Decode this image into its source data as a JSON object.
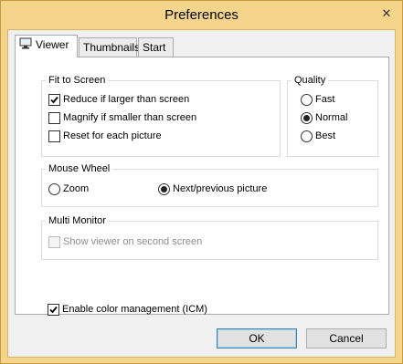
{
  "window": {
    "title": "Preferences",
    "close_glyph": "✕"
  },
  "tabs": [
    {
      "label": "Viewer",
      "icon": "monitor-icon",
      "active": true
    },
    {
      "label": "Thumbnails",
      "active": false
    },
    {
      "label": "Start",
      "active": false
    }
  ],
  "fit_to_screen": {
    "title": "Fit to Screen",
    "options": [
      {
        "label": "Reduce if larger than screen",
        "checked": true
      },
      {
        "label": "Magnify if smaller than screen",
        "checked": false
      },
      {
        "label": "Reset for each picture",
        "checked": false
      }
    ]
  },
  "quality": {
    "title": "Quality",
    "options": [
      {
        "label": "Fast",
        "selected": false
      },
      {
        "label": "Normal",
        "selected": true
      },
      {
        "label": "Best",
        "selected": false
      }
    ]
  },
  "mouse_wheel": {
    "title": "Mouse Wheel",
    "options": [
      {
        "label": "Zoom",
        "selected": false
      },
      {
        "label": "Next/previous picture",
        "selected": true
      }
    ]
  },
  "multi_monitor": {
    "title": "Multi Monitor",
    "option": {
      "label": "Show viewer on second screen",
      "checked": false,
      "enabled": false
    }
  },
  "color_management": {
    "label": "Enable color management (ICM)",
    "checked": true
  },
  "buttons": {
    "ok": "OK",
    "cancel": "Cancel"
  }
}
